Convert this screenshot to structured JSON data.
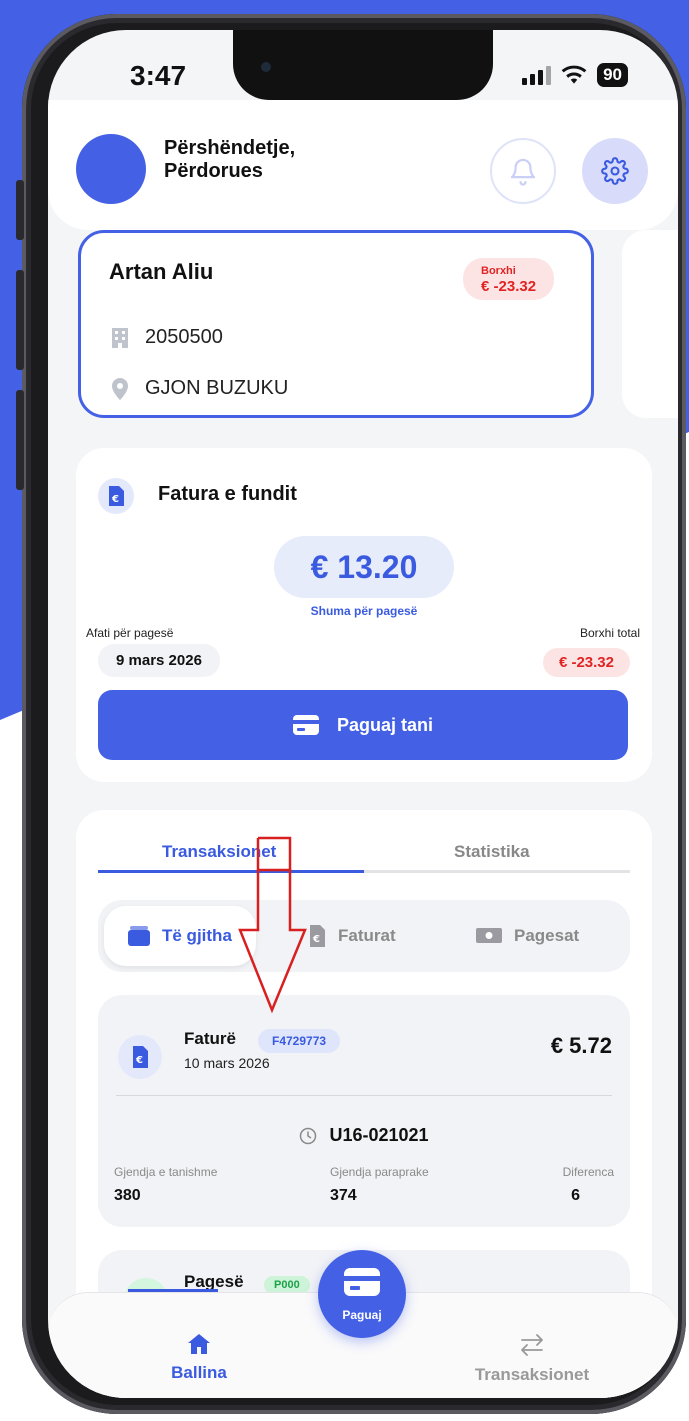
{
  "status_bar": {
    "time": "3:47",
    "battery": "90"
  },
  "header": {
    "greeting_line1": "Përshëndetje,",
    "greeting_line2": "Përdorues"
  },
  "account": {
    "name": "Artan Aliu",
    "debt_label": "Borxhi",
    "debt_value": "€ -23.32",
    "number": "2050500",
    "street": "GJON BUZUKU"
  },
  "last_bill": {
    "title": "Fatura e fundit",
    "amount": "€ 13.20",
    "amount_caption": "Shuma për pagesë",
    "due_label": "Afati për pagesë",
    "due_date": "9 mars 2026",
    "total_debt_label": "Borxhi total",
    "total_debt_value": "€ -23.32",
    "pay_button": "Paguaj tani"
  },
  "tabs": {
    "transactions": "Transaksionet",
    "statistics": "Statistika"
  },
  "filters": {
    "all": "Të gjitha",
    "bills": "Faturat",
    "payments": "Pagesat"
  },
  "transaction": {
    "type": "Faturë",
    "code": "F4729773",
    "date": "10 mars 2026",
    "amount": "€ 5.72",
    "meter": "U16-021021",
    "current_label": "Gjendja e tanishme",
    "current_value": "380",
    "previous_label": "Gjendja paraprake",
    "previous_value": "374",
    "diff_label": "Diferenca",
    "diff_value": "6"
  },
  "transaction2": {
    "type": "Pagesë",
    "code": "P000"
  },
  "bottom_nav": {
    "home": "Ballina",
    "pay": "Paguaj",
    "transactions": "Transaksionet"
  },
  "colors": {
    "primary": "#4461e6",
    "debt_red": "#e02424",
    "background": "#f4f5f7"
  }
}
